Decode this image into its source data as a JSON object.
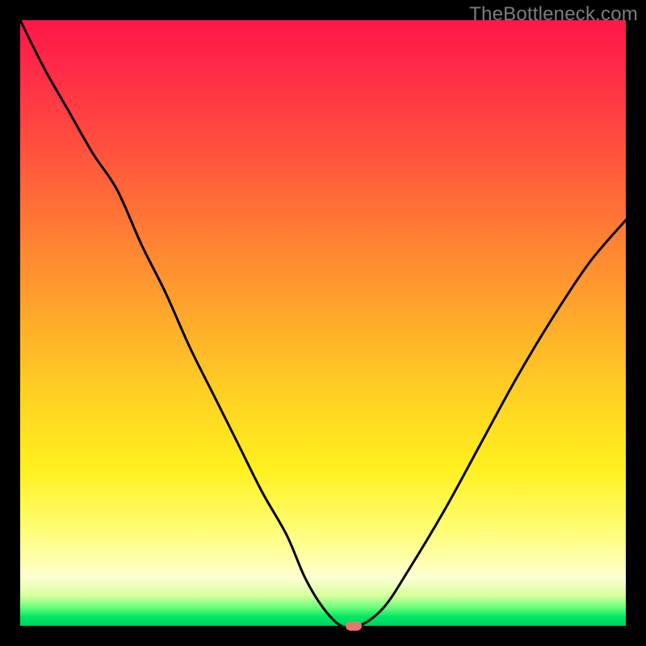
{
  "watermark": "TheBottleneck.com",
  "colors": {
    "frame": "#000000",
    "curve_stroke": "#000000",
    "marker_fill": "#e07a6e"
  },
  "chart_data": {
    "type": "line",
    "title": "",
    "xlabel": "",
    "ylabel": "",
    "xlim": [
      0,
      100
    ],
    "ylim": [
      0,
      100
    ],
    "grid": false,
    "legend": false,
    "series": [
      {
        "name": "bottleneck-curve",
        "x": [
          0,
          4,
          8,
          12,
          16,
          20,
          24,
          28,
          32,
          36,
          40,
          44,
          47,
          50,
          53,
          56,
          60,
          64,
          70,
          76,
          82,
          88,
          94,
          100
        ],
        "y": [
          100,
          92,
          85,
          78,
          72,
          63,
          55,
          46,
          38,
          30,
          22,
          15,
          8,
          3,
          0,
          0,
          3,
          9,
          19,
          30,
          41,
          51,
          60,
          67
        ]
      }
    ],
    "marker": {
      "x": 55,
      "y": 0
    },
    "background_gradient": {
      "stops": [
        {
          "pos": 0,
          "color": "#ff1747"
        },
        {
          "pos": 34,
          "color": "#ff7a35"
        },
        {
          "pos": 62,
          "color": "#ffd123"
        },
        {
          "pos": 88,
          "color": "#ffffa0"
        },
        {
          "pos": 97,
          "color": "#64ff7a"
        },
        {
          "pos": 100,
          "color": "#00d060"
        }
      ]
    }
  }
}
